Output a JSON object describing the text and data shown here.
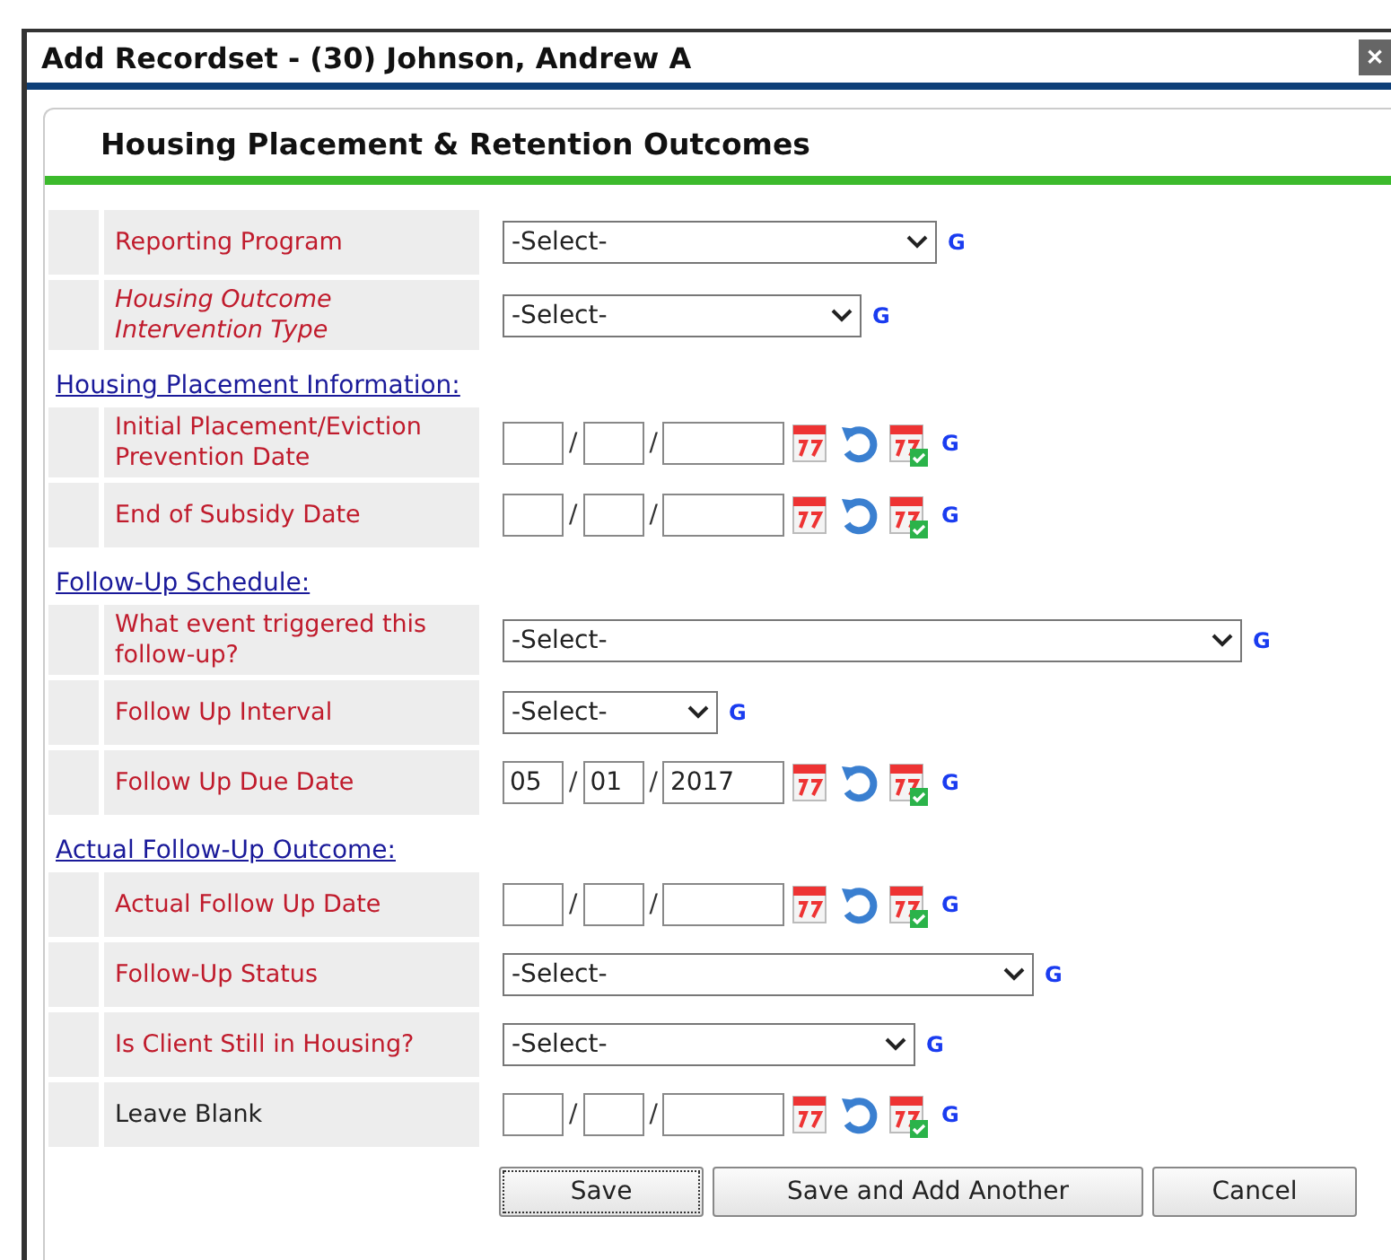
{
  "window": {
    "title": "Add Recordset - (30) Johnson, Andrew A",
    "close_label": "✕"
  },
  "panel": {
    "title": "Housing Placement & Retention Outcomes"
  },
  "rows": [
    {
      "kind": "select",
      "label": "Reporting Program",
      "required": true,
      "italic": false,
      "value": "-Select-",
      "g": "G"
    },
    {
      "kind": "select",
      "label": "Housing Outcome Intervention Type",
      "required": true,
      "italic": true,
      "value": "-Select-",
      "g": "G"
    },
    {
      "kind": "section",
      "label": "Housing Placement Information:"
    },
    {
      "kind": "date",
      "label": "Initial Placement/Eviction Prevention Date",
      "required": true,
      "italic": false,
      "month": "",
      "day": "",
      "year": "",
      "g": "G"
    },
    {
      "kind": "date",
      "label": "End of Subsidy Date",
      "required": true,
      "italic": false,
      "month": "",
      "day": "",
      "year": "",
      "g": "G"
    },
    {
      "kind": "section",
      "label": "Follow-Up Schedule:"
    },
    {
      "kind": "select",
      "label": "What event triggered this follow-up?",
      "required": true,
      "italic": false,
      "value": "-Select-",
      "g": "G"
    },
    {
      "kind": "select",
      "label": "Follow Up Interval",
      "required": true,
      "italic": false,
      "value": "-Select-",
      "g": "G"
    },
    {
      "kind": "date",
      "label": "Follow Up Due Date",
      "required": true,
      "italic": false,
      "month": "05",
      "day": "01",
      "year": "2017",
      "g": "G"
    },
    {
      "kind": "section",
      "label": "Actual Follow-Up Outcome:"
    },
    {
      "kind": "date",
      "label": "Actual Follow Up Date",
      "required": true,
      "italic": false,
      "month": "",
      "day": "",
      "year": "",
      "g": "G"
    },
    {
      "kind": "select",
      "label": "Follow-Up Status",
      "required": true,
      "italic": false,
      "value": "-Select-",
      "g": "G"
    },
    {
      "kind": "select",
      "label": "Is Client Still in Housing?",
      "required": true,
      "italic": false,
      "value": "-Select-",
      "g": "G"
    },
    {
      "kind": "date",
      "label": "Leave Blank",
      "required": false,
      "italic": false,
      "month": "",
      "day": "",
      "year": "",
      "g": "G"
    }
  ],
  "date_separator": "/",
  "buttons": [
    {
      "label": "Save",
      "focused": true
    },
    {
      "label": "Save and Add Another",
      "focused": false
    },
    {
      "label": "Cancel",
      "focused": false
    }
  ]
}
